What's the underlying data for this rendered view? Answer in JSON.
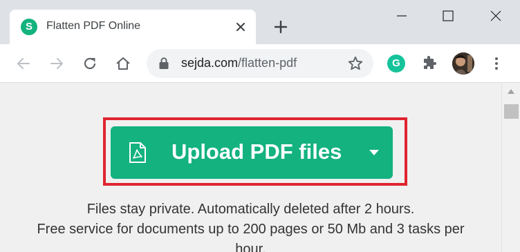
{
  "browser": {
    "tab": {
      "favicon_letter": "S",
      "title": "Flatten PDF Online"
    },
    "icons": [
      "close-icon",
      "plus-icon",
      "minimize-icon",
      "maximize-icon",
      "window-close-icon"
    ],
    "toolbar": {
      "url_host": "sejda.com",
      "url_path": "/flatten-pdf",
      "grammarly_letter": "G"
    }
  },
  "page": {
    "upload_button_label": "Upload PDF files",
    "privacy_note": "Files stay private. Automatically deleted after 2 hours.",
    "service_note_line1": "Free service for documents up to 200 pages or 50 Mb and 3 tasks per",
    "service_note_line2": "hour."
  },
  "colors": {
    "brand_green": "#13b27f",
    "highlight_red": "#e0242f",
    "page_background": "#f0f0f0"
  }
}
